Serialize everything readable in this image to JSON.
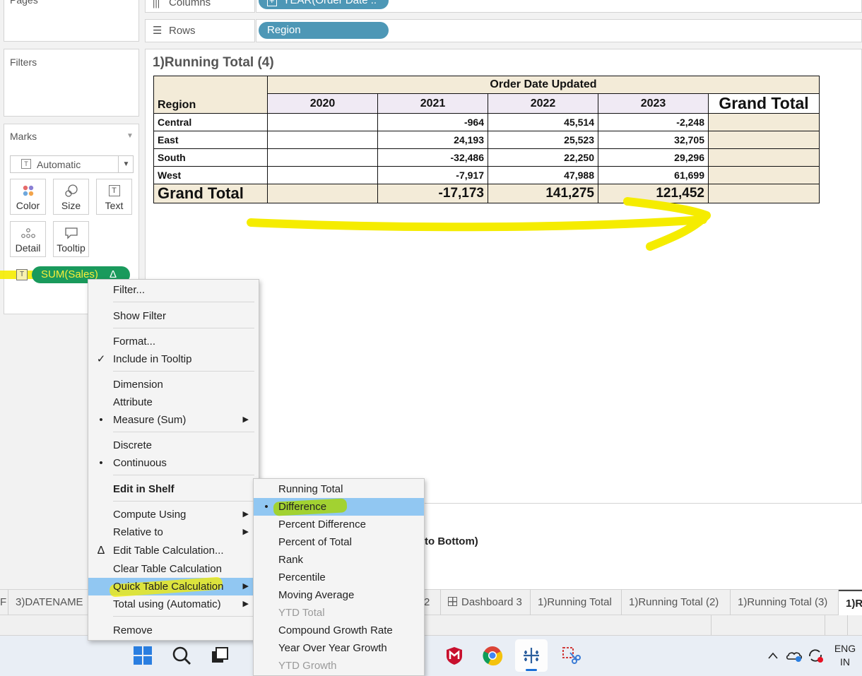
{
  "shelves": {
    "pages_label": "Pages",
    "columns_label": "Columns",
    "columns_pill": "YEAR(Order Date ..",
    "rows_label": "Rows",
    "rows_pill": "Region"
  },
  "filters_label": "Filters",
  "marks": {
    "title": "Marks",
    "type_value": "Automatic",
    "buttons": [
      "Color",
      "Size",
      "Text",
      "Detail",
      "Tooltip"
    ],
    "pill": "SUM(Sales)",
    "pill_badge": "Δ"
  },
  "sheet": {
    "title": "1)Running Total (4)",
    "header_group": "Order Date Updated",
    "row_header": "Region",
    "years": [
      "2020",
      "2021",
      "2022",
      "2023"
    ],
    "grand_total_col": "Grand Total",
    "rows": [
      {
        "region": "Central",
        "values": [
          "",
          "-964",
          "45,514",
          "-2,248"
        ]
      },
      {
        "region": "East",
        "values": [
          "",
          "24,193",
          "25,523",
          "32,705"
        ]
      },
      {
        "region": "South",
        "values": [
          "",
          "-32,486",
          "22,250",
          "29,296"
        ]
      },
      {
        "region": "West",
        "values": [
          "",
          "-7,917",
          "47,988",
          "61,699"
        ]
      }
    ],
    "grand_total_row": {
      "label": "Grand Total",
      "values": [
        "",
        "-17,173",
        "141,275",
        "121,452"
      ]
    },
    "behind_text": "to Bottom)"
  },
  "context_menu": [
    {
      "label": "Filter..."
    },
    {
      "label": "Show Filter"
    },
    {
      "label": "Format..."
    },
    {
      "label": "Include in Tooltip",
      "mark": "✓"
    },
    {
      "label": "Dimension"
    },
    {
      "label": "Attribute"
    },
    {
      "label": "Measure (Sum)",
      "mark": "•",
      "submenu": true
    },
    {
      "label": "Discrete"
    },
    {
      "label": "Continuous",
      "mark": "•"
    },
    {
      "label": "Edit in Shelf"
    },
    {
      "label": "Compute Using"
    },
    {
      "label": "Relative to"
    },
    {
      "label": "Edit Table Calculation...",
      "mark": "Δ"
    },
    {
      "label": "Clear Table Calculation"
    },
    {
      "label": "Quick Table Calculation"
    },
    {
      "label": "Total using (Automatic)"
    },
    {
      "label": "Remove"
    }
  ],
  "submenu": [
    {
      "label": "Running Total"
    },
    {
      "label": "Difference",
      "mark": "•"
    },
    {
      "label": "Percent Difference"
    },
    {
      "label": "Percent of Total"
    },
    {
      "label": "Rank"
    },
    {
      "label": "Percentile"
    },
    {
      "label": "Moving Average"
    },
    {
      "label": "YTD Total"
    },
    {
      "label": "Compound Growth Rate"
    },
    {
      "label": "Year Over Year Growth"
    },
    {
      "label": "YTD Growth"
    }
  ],
  "tabs": {
    "left_fragment": "F",
    "left": "3)DATENAME",
    "hidden_fragment": "2",
    "items": [
      "Dashboard 3",
      "1)Running Total",
      "1)Running Total (2)",
      "1)Running Total (3)",
      "1)R"
    ]
  },
  "taskbar": {
    "lang_line1": "ENG",
    "lang_line2": "IN"
  },
  "colors": {
    "pill_blue": "#4d97b6",
    "pill_green": "#1a9a5c",
    "highlight_yellow": "#f5ec00",
    "menu_highlight": "#91c7f2"
  }
}
